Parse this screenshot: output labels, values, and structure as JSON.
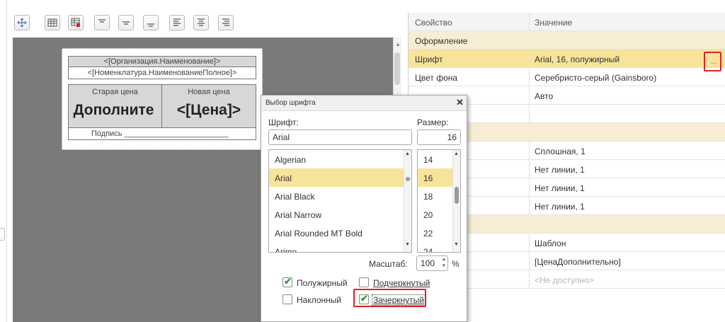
{
  "toolbar": {
    "buttons": [
      "move-icon",
      "table-icon",
      "table-delete-icon",
      "align-top-icon",
      "align-middle-icon",
      "align-bottom-icon",
      "align-left-icon",
      "align-center-icon",
      "align-right-icon"
    ]
  },
  "template": {
    "org": "<[Организация.Наименование]>",
    "nomen": "<[Номенклатура.НаименованиеПолное]>",
    "old_price_label": "Старая цена",
    "new_price_label": "Новая цена",
    "old_price_value": "Дополните",
    "new_price_value": "<[Цена]>",
    "signature": "Подпись ________________________"
  },
  "props": {
    "header": {
      "name": "Свойство",
      "value": "Значение"
    },
    "rows": [
      {
        "name": "Оформление",
        "value": "",
        "category": true
      },
      {
        "name": "Шрифт",
        "value": "Arial, 16, полужирный",
        "selected": true
      },
      {
        "name": "Цвет фона",
        "value": "Серебристо-серый (Gainsboro)"
      },
      {
        "name": "",
        "value": "Авто"
      },
      {
        "name": "кста",
        "value": ""
      },
      {
        "name": "",
        "value": "",
        "category": true
      },
      {
        "name": "",
        "value": "Сплошная, 1"
      },
      {
        "name": "у",
        "value": "Нет линии, 1"
      },
      {
        "name": "а",
        "value": "Нет линии, 1"
      },
      {
        "name": "",
        "value": "Нет линии, 1"
      },
      {
        "name": "",
        "value": "",
        "category": true
      },
      {
        "name": "",
        "value": "Шаблон"
      },
      {
        "name": "",
        "value": "[ЦенаДополнительно]"
      },
      {
        "name": "",
        "value": "<Не доступно>",
        "disabled": true
      }
    ],
    "ellipsis": "..."
  },
  "font_dialog": {
    "title": "Выбор шрифта",
    "font_label": "Шрифт:",
    "font_value": "Arial",
    "size_label": "Размер:",
    "size_value": "16",
    "fonts": [
      "Algerian",
      "Arial",
      "Arial Black",
      "Arial Narrow",
      "Arial Rounded MT Bold",
      "Arimo"
    ],
    "selected_font": "Arial",
    "sizes": [
      "14",
      "16",
      "18",
      "20",
      "22",
      "24"
    ],
    "selected_size": "16",
    "scale_label": "Масштаб:",
    "scale_value": "100",
    "scale_unit": "%",
    "bold_label": "Полужирный",
    "bold_checked": true,
    "underline_label": "Подчеркнутый",
    "underline_checked": false,
    "italic_label": "Наклонный",
    "italic_checked": false,
    "strike_label": "Зачеркнутый",
    "strike_checked": true,
    "close": "✕"
  },
  "colors": {
    "category_bg": "#f6edd4",
    "selected_bg": "#f8e39a",
    "highlight": "#d8232a",
    "canvas": "#7a7a7a"
  }
}
